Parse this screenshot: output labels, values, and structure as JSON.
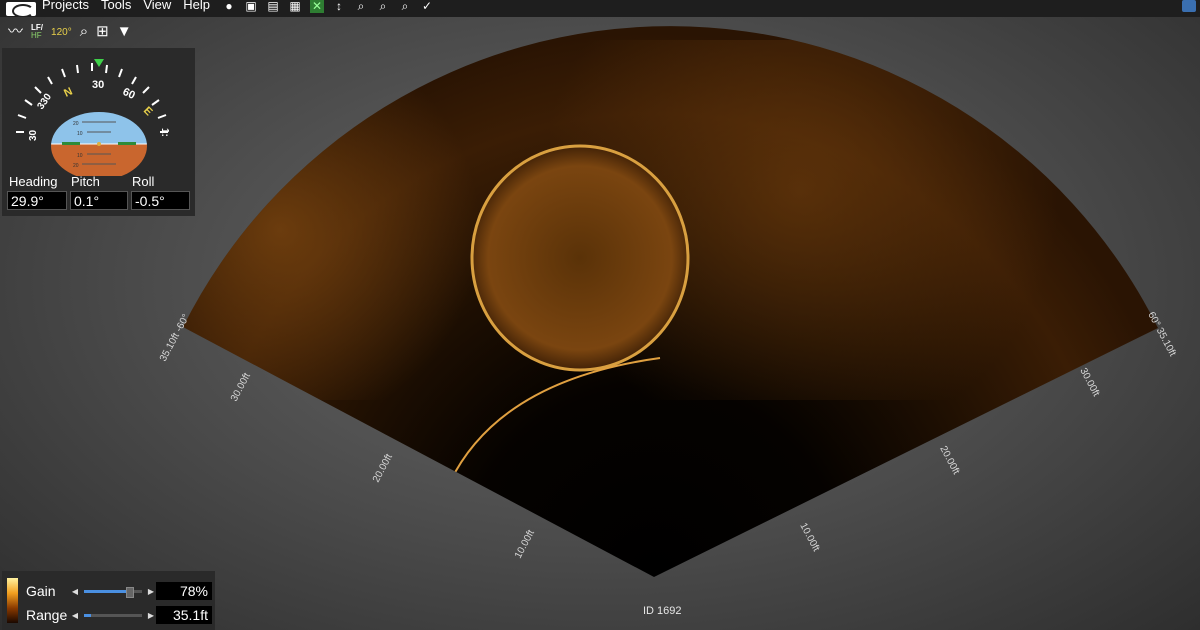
{
  "menubar": {
    "items": [
      "Projects",
      "Tools",
      "View",
      "Help"
    ]
  },
  "toolbar": {
    "frequency_top": "LF/",
    "frequency_bottom": "HF",
    "beam_angle": "120°"
  },
  "attitude": {
    "compass_labels": [
      "330",
      "N",
      "30",
      "60",
      "E"
    ],
    "side_labels": [
      "30",
      "1:"
    ],
    "pitch_ticks": [
      "20",
      "10",
      "10",
      "20"
    ],
    "heading_label": "Heading",
    "pitch_label": "Pitch",
    "roll_label": "Roll",
    "heading_value": "29.9°",
    "pitch_value": "0.1°",
    "roll_value": "-0.5°"
  },
  "sonar": {
    "left_ranges": [
      "10.00ft",
      "20.00ft",
      "30.00ft",
      "35.10ft -60°"
    ],
    "right_ranges": [
      "10.00ft",
      "20.00ft",
      "30.00ft",
      "60° 35.10ft"
    ],
    "id_label": "ID 1692"
  },
  "controls": {
    "gain_label": "Gain",
    "gain_value": "78%",
    "gain_level": 0.78,
    "range_label": "Range",
    "range_value": "35.1ft",
    "range_level": 0.12
  }
}
